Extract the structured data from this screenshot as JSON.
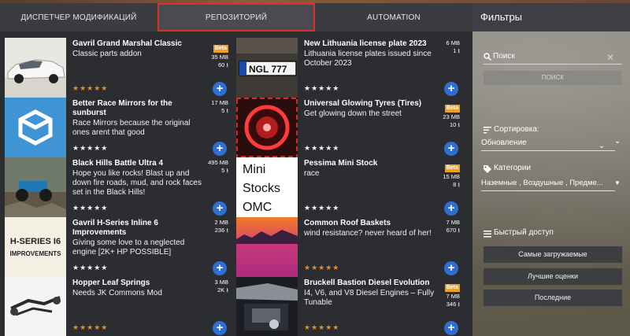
{
  "tabs": [
    {
      "label": "Диспетчер модификаций"
    },
    {
      "label": "Репозиторий",
      "active": true
    },
    {
      "label": "Automation"
    }
  ],
  "colors": {
    "accent": "#2f6fd1",
    "beta": "#f0a020",
    "star": "#f08a1a",
    "tab_active_border": "#d9302c"
  },
  "mods": [
    {
      "name": "Gavril Grand Marshal Classic",
      "desc": "Classic parts addon",
      "beta": "Beta",
      "size": "35 MB",
      "downloads": "60",
      "stars": "★★★★★",
      "star_color": "gold",
      "thumb_icon": "car-photo-icon"
    },
    {
      "name": "New Lithuania license plate 2023",
      "desc": "Lithuania license plates issued since October 2023",
      "beta": "",
      "size": "6 MB",
      "downloads": "1",
      "stars": "★★★★★",
      "star_color": "white",
      "thumb_icon": "license-plate-icon",
      "plate_text": "NGL 777"
    },
    {
      "name": "Better Race Mirrors for the sunburst",
      "desc": "Race Mirrors because the original ones arent that good",
      "beta": "",
      "size": "17 MB",
      "downloads": "5",
      "stars": "★★★★★",
      "star_color": "white",
      "thumb_icon": "box-icon"
    },
    {
      "name": "Universal Glowing Tyres (Tires)",
      "desc": "Get glowing down the street",
      "beta": "Beta",
      "size": "23 MB",
      "downloads": "10",
      "stars": "★★★★★",
      "star_color": "white",
      "thumb_icon": "glowing-tyre-icon"
    },
    {
      "name": "Black Hills Battle Ultra 4",
      "desc": "Hope you like rocks! Blast up and down fire roads, mud, and rock faces set in the Black Hills!",
      "beta": "",
      "size": "495 MB",
      "downloads": "5",
      "stars": "★★★★★",
      "star_color": "white",
      "thumb_icon": "offroad-vehicle-icon"
    },
    {
      "name": "Pessima Mini Stock",
      "desc": "race",
      "beta": "Beta",
      "size": "15 MB",
      "downloads": "8",
      "stars": "★★★★★",
      "star_color": "white",
      "thumb_icon": "text-logo-icon",
      "thumb_text": [
        "Mini",
        "Stocks",
        "OMC"
      ]
    },
    {
      "name": "Gavril H-Series Inline 6 Improvements",
      "desc": "Giving some love to a neglected engine [2K+ HP POSSIBLE]",
      "beta": "",
      "size": "2 MB",
      "downloads": "236",
      "stars": "★★★★★",
      "star_color": "white",
      "thumb_icon": "engine-logo-icon",
      "thumb_text": [
        "H-SERIES I6",
        "IMPROVEMENTS"
      ]
    },
    {
      "name": "Common Roof Baskets",
      "desc": "wind resistance? never heard of her!",
      "beta": "",
      "size": "7 MB",
      "downloads": "670",
      "stars": "★★★★★",
      "star_color": "gold",
      "thumb_icon": "sunset-landscape-icon"
    },
    {
      "name": "Hopper Leaf Springs",
      "desc": "Needs JK Commons Mod",
      "beta": "",
      "size": "3 MB",
      "downloads": "2K",
      "stars": "★★★★★",
      "star_color": "gold",
      "thumb_icon": "suspension-icon"
    },
    {
      "name": "Bruckell Bastion Diesel Evolution",
      "desc": "I4, V6, and V8 Diesel Engines – Fully Tunable",
      "beta": "Beta",
      "size": "7 MB",
      "downloads": "346",
      "stars": "★★★★★",
      "star_color": "gold",
      "thumb_icon": "engine-bay-icon"
    }
  ],
  "sidebar": {
    "title": "Фильтры",
    "search_label": "Поиск",
    "search_button": "ПОИСК",
    "sort_label": "Сортировка:",
    "sort_value": "Обновление",
    "categories_label": "Категории",
    "categories_value": "Наземные , Воздушные , Предме...",
    "quick_label": "Быстрый доступ",
    "quick_buttons": [
      "Самые загружаемые",
      "Лучшие оценки",
      "Последние"
    ]
  }
}
